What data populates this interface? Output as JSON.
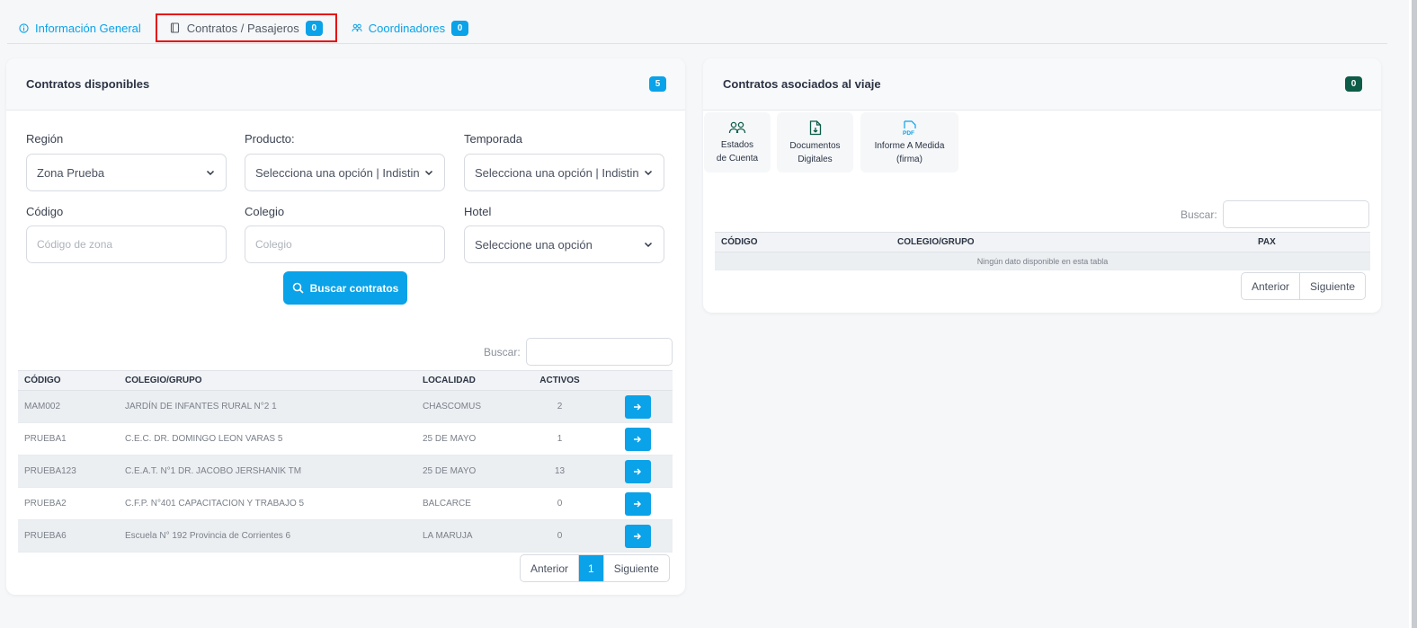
{
  "tabs": {
    "general": {
      "label": "Información General"
    },
    "contratos": {
      "label": "Contratos / Pasajeros",
      "count": "0"
    },
    "coordinadores": {
      "label": "Coordinadores",
      "count": "0"
    }
  },
  "left": {
    "title": "Contratos disponibles",
    "count": "5",
    "filters": {
      "region": {
        "label": "Región",
        "value": "Zona Prueba"
      },
      "producto": {
        "label": "Producto:",
        "value": "Selecciona una opción | Indistinto"
      },
      "temporada": {
        "label": "Temporada",
        "value": "Selecciona una opción | Indistinto"
      },
      "codigo": {
        "label": "Código",
        "placeholder": "Código de zona"
      },
      "colegio": {
        "label": "Colegio",
        "placeholder": "Colegio"
      },
      "hotel": {
        "label": "Hotel",
        "value": "Seleccione una opción"
      }
    },
    "search_button": "Buscar contratos",
    "search_label": "Buscar:",
    "table": {
      "headers": [
        "CÓDIGO",
        "COLEGIO/GRUPO",
        "LOCALIDAD",
        "ACTIVOS"
      ],
      "rows": [
        {
          "codigo": "MAM002",
          "colegio": "JARDÍN DE INFANTES RURAL N°2 1",
          "localidad": "CHASCOMUS",
          "activos": "2"
        },
        {
          "codigo": "PRUEBA1",
          "colegio": "C.E.C. DR. DOMINGO LEON VARAS 5",
          "localidad": "25 DE MAYO",
          "activos": "1"
        },
        {
          "codigo": "PRUEBA123",
          "colegio": "C.E.A.T. N°1 DR. JACOBO JERSHANIK TM",
          "localidad": "25 DE MAYO",
          "activos": "13"
        },
        {
          "codigo": "PRUEBA2",
          "colegio": "C.F.P. N°401 CAPACITACION Y TRABAJO 5",
          "localidad": "BALCARCE",
          "activos": "0"
        },
        {
          "codigo": "PRUEBA6",
          "colegio": "Escuela N° 192 Provincia de Corrientes 6",
          "localidad": "LA MARUJA",
          "activos": "0"
        }
      ]
    },
    "pager": {
      "prev": "Anterior",
      "page": "1",
      "next": "Siguiente"
    }
  },
  "right": {
    "title": "Contratos asociados al viaje",
    "count": "0",
    "actions": [
      {
        "label1": "Estados",
        "label2": "de Cuenta",
        "icon": "users-icon"
      },
      {
        "label1": "Documentos",
        "label2": "Digitales",
        "icon": "document-icon"
      },
      {
        "label1": "Informe A Medida",
        "label2": "(firma)",
        "icon": "pdf-icon"
      }
    ],
    "search_label": "Buscar:",
    "table": {
      "headers": [
        "CÓDIGO",
        "COLEGIO/GRUPO",
        "PAX"
      ],
      "empty": "Ningún dato disponible en esta tabla"
    },
    "pager": {
      "prev": "Anterior",
      "next": "Siguiente"
    }
  },
  "colors": {
    "accent": "#0aa2e8",
    "dark_badge": "#0d5c48",
    "active_tab_border": "#e50b0b"
  }
}
